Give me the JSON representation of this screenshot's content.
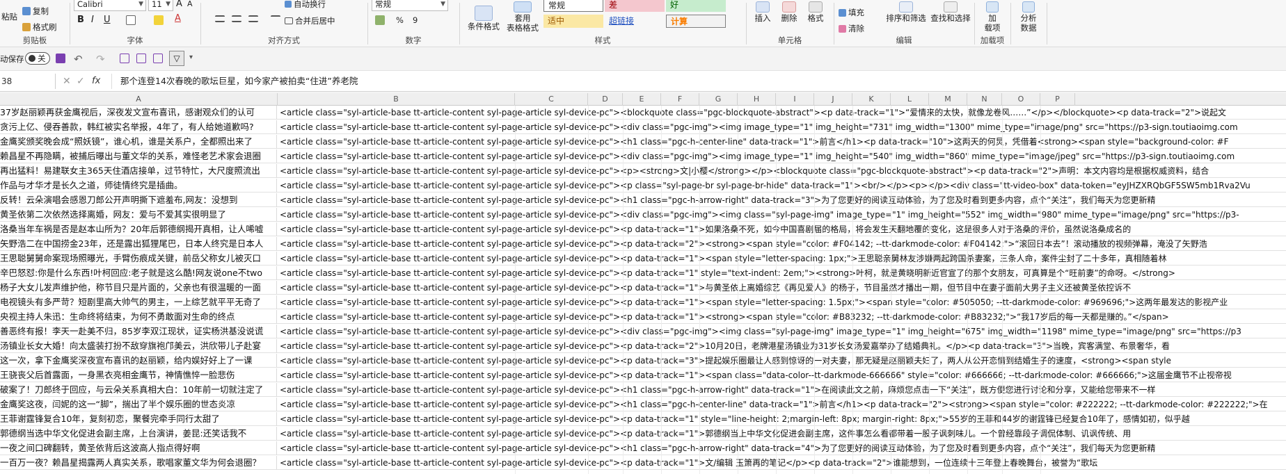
{
  "ribbon": {
    "clipboard": {
      "paste": "粘贴",
      "copy": "复制",
      "format_painter": "格式刷",
      "label": "剪贴板"
    },
    "font": {
      "name": "Calibri",
      "size": "11",
      "inc": "A",
      "dec": "A",
      "bold": "B",
      "italic": "I",
      "underline": "U",
      "font_color": "A",
      "label": "字体"
    },
    "alignment": {
      "wrap": "自动换行",
      "merge": "合并后居中",
      "label": "对齐方式"
    },
    "number": {
      "format": "常规",
      "percent": "%",
      "comma": "9",
      "label": "数字"
    },
    "styles": {
      "cond_format": "条件格式",
      "table_format_1": "套用",
      "table_format_2": "表格格式",
      "s_normal": "常规",
      "s_bad": "差",
      "s_good": "好",
      "s_neutral": "适中",
      "s_link": "超链接",
      "s_calc": "计算",
      "label": "样式"
    },
    "cells": {
      "insert": "插入",
      "delete": "删除",
      "format": "格式",
      "label": "单元格"
    },
    "editing": {
      "fill": "填充",
      "clear": "清除",
      "sort": "排序和筛选",
      "find": "查找和选择",
      "label": "编辑"
    },
    "addins": {
      "addin_1": "加",
      "addin_2": "载项",
      "label": "加载项"
    },
    "analysis": {
      "line1": "分析",
      "line2": "数据"
    }
  },
  "qat": {
    "autosave": "动保存",
    "toggle": "关"
  },
  "formula_bar": {
    "name_box": "38",
    "fx": "fx",
    "content": "那个连登14次春晚的歌坛巨星，如今家产被拍卖“住进”养老院"
  },
  "columns": [
    "A",
    "B",
    "C",
    "D",
    "E",
    "F",
    "G",
    "H",
    "I",
    "J",
    "K",
    "L",
    "M",
    "N",
    "O",
    "P"
  ],
  "rows": [
    {
      "a": "37岁赵丽颖再获金鹰视后，深夜发文宣布喜讯，感谢观众们的认可",
      "b": "<article class=\"syl-article-base tt-article-content syl-page-article syl-device-pc\"><blockquote class=\"pgc-blockquote-abstract\"><p data-track=\"1\">“爱情来的太快，就像龙卷风……”</p></blockquote><p data-track=\"2\">说起文"
    },
    {
      "a": "贪污上亿、侵吞善款，韩红被实名举报，4年了，有人给她道歉吗?",
      "b": "<article class=\"syl-article-base tt-article-content syl-page-article syl-device-pc\"><div class=\"pgc-img\"><img image_type=\"1\" img_height=\"731\" img_width=\"1300\" mime_type=\"image/png\" src=\"https://p3-sign.toutiaoimg.com"
    },
    {
      "a": "金鹰奖颁奖晚会成“照妖镜”，谁心机，谁是关系户，全都照出来了",
      "b": "<article class=\"syl-article-base tt-article-content syl-page-article syl-device-pc\"><h1 class=\"pgc-h-center-line\" data-track=\"1\">前言</h1><p data-track=\"10\">这两天的何炅，凭借着<strong><span style=\"background-color: #F"
    },
    {
      "a": "赖昌星不再隐瞒，被捕后曝出与董文华的关系，难怪老艺术家会退圈",
      "b": "<article class=\"syl-article-base tt-article-content syl-page-article syl-device-pc\"><div class=\"pgc-img\"><img image_type=\"1\" img_height=\"540\" img_width=\"860\" mime_type=\"image/jpeg\" src=\"https://p3-sign.toutiaoimg.com"
    },
    {
      "a": "再出猛料！易建联女主365天住酒店接单，过节特忙，大尺度照流出",
      "b": "<article class=\"syl-article-base tt-article-content syl-page-article syl-device-pc\"><p><strong>文|小樱</strong></p><blockquote class=\"pgc-blockquote-abstract\"><p data-track=\"2\">声明：本文内容均是根据权威资料，结合"
    },
    {
      "a": "作品与才华才是长久之道，师徒情终究是插曲。",
      "b": "<article class=\"syl-article-base tt-article-content syl-page-article syl-device-pc\"><p class=\"syl-page-br syl-page-br-hide\" data-track=\"1\"><br/></p><p></p><div class=\"tt-video-box\" data-token=\"eyJHZXRQbGF5SW5mb1Rva2Vu"
    },
    {
      "a": "反转！云朵演唱会感恩刀郎公开声明撕下遮羞布,网友：没想到",
      "b": "<article class=\"syl-article-base tt-article-content syl-page-article syl-device-pc\"><h1 class=\"pgc-h-arrow-right\" data-track=\"3\">为了您更好的阅读互动体验，为了您及时看到更多内容，点个“关注”，我们每天为您更新精"
    },
    {
      "a": "黄圣依第二次依然选择离婚，网友：爱与不爱其实很明显了",
      "b": "<article class=\"syl-article-base tt-article-content syl-page-article syl-device-pc\"><div class=\"pgc-img\"><img class=\"syl-page-img\" image_type=\"1\" img_height=\"552\" img_width=\"980\" mime_type=\"image/png\" src=\"https://p3-"
    },
    {
      "a": "洛桑当年车祸是否是赵本山所为？20年后郭德纲揭开真相，让人唏嘘",
      "b": "<article class=\"syl-article-base tt-article-content syl-page-article syl-device-pc\"><p data-track=\"1\">如果洛桑不死，如今中国喜剧届的格局，将会发生天翻地覆的变化，这是很多人对于洛桑的评价，虽然说洛桑成名的"
    },
    {
      "a": "矢野浩二在中国捞金23年，还是露出狐狸尾巴，日本人终究是日本人",
      "b": "<article class=\"syl-article-base tt-article-content syl-page-article syl-device-pc\"><p data-track=\"2\"><strong><span style=\"color: #F04142; --tt-darkmode-color: #F04142;\">“滚回日本去”！滚动播放的视频弹幕，淹没了矢野浩"
    },
    {
      "a": "王思聪舅舅命案现场照曝光，手臂伤痕成关键，前岳父称女儿被灭口",
      "b": "<article class=\"syl-article-base tt-article-content syl-page-article syl-device-pc\"><p data-track=\"1\"><span style=\"letter-spacing: 1px;\">王思聪亲舅林友涉嫌两起跨国杀妻案，三条人命，案件尘封了二十多年，真相随着林"
    },
    {
      "a": "辛巴怒怼:你是什么东西!叶柯回应:老子就是这么酷!网友说one不two",
      "b": "<article class=\"syl-article-base tt-article-content syl-page-article syl-device-pc\"><p data-track=\"1\" style=\"text-indent: 2em;\"><strong>叶柯，就是黄晓明新近官宣了的那个女朋友，可真算是个“旺前妻”的命呀。</strong>"
    },
    {
      "a": "杨子大女儿发声维护他，称节目只是片面的，父亲也有很温暖的一面",
      "b": "<article class=\"syl-article-base tt-article-content syl-page-article syl-device-pc\"><p data-track=\"1\">与黄圣依上离婚综艺《再见爱人》的杨子，节目虽然才播出一期，但节目中在妻子面前大男子主义还被黄圣依控诉不"
    },
    {
      "a": "电视镜头有多严苛？短剧里高大帅气的男主，一上综艺就平平无奇了",
      "b": "<article class=\"syl-article-base tt-article-content syl-page-article syl-device-pc\"><p data-track=\"1\"><span style=\"letter-spacing: 1.5px;\"><span style=\"color: #505050; --tt-darkmode-color: #969696;\">这两年最发达的影视产业"
    },
    {
      "a": "央视主持人朱迅：生命终将结束，为何不勇敢面对生命的终点",
      "b": "<article class=\"syl-article-base tt-article-content syl-page-article syl-device-pc\"><p data-track=\"1\"><strong><span style=\"color: #B83232; --tt-darkmode-color: #B83232;\">“我17岁后的每一天都是赚的。”</span>"
    },
    {
      "a": "善恶终有报！李天一赴美不归，85岁李双江现状，证实杨洪基没说谎",
      "b": "<article class=\"syl-article-base tt-article-content syl-page-article syl-device-pc\"><div class=\"pgc-img\"><img class=\"syl-page-img\" image_type=\"1\" img_height=\"675\" img_width=\"1198\" mime_type=\"image/png\" src=\"https://p3"
    },
    {
      "a": "汤镇业长女大婚！向太盛装打扮不敌穿旗袍邝美云，洪欣带儿子赴宴",
      "b": "<article class=\"syl-article-base tt-article-content syl-page-article syl-device-pc\"><p data-track=\"2\">10月20日，老牌港星汤镇业为31岁长女汤爱嘉举办了结婚典礼。</p><p data-track=\"3\">当晚，宾客满堂、布景奢华，看"
    },
    {
      "a": "这一次，拿下金鹰奖深夜宣布喜讯的赵丽颖，给内娱好好上了一课",
      "b": "<article class=\"syl-article-base tt-article-content syl-page-article syl-device-pc\"><p data-track=\"3\">提起娱乐圈最让人感到惊讶的一对夫妻，那无疑是赵丽颖夫妇了，两人从公开恋情到结婚生子的速度，<strong><span style"
    },
    {
      "a": "王骁丧父后首露面，一身黑衣亮相金鹰节，神情憔悴一脸悲伤",
      "b": "<article class=\"syl-article-base tt-article-content syl-page-article syl-device-pc\"><p data-track=\"1\"><span class=\"data-color--tt-darkmode-666666\" style=\"color: #666666; --tt-darkmode-color: #666666;\">这届金鹰节不止视帝视"
    },
    {
      "a": "破案了！刀郎终于回应，与云朵关系真相大白：10年前一切就注定了",
      "b": "<article class=\"syl-article-base tt-article-content syl-page-article syl-device-pc\"><h1 class=\"pgc-h-arrow-right\" data-track=\"1\">在阅读此文之前，麻烦您点击一下“关注”，既方便您进行讨论和分享，又能给您带来不一样"
    },
    {
      "a": "金鹰奖这夜，闫妮的这一“脚”，揣出了半个娱乐圈的世态炎凉",
      "b": "<article class=\"syl-article-base tt-article-content syl-page-article syl-device-pc\"><h1 class=\"pgc-h-center-line\" data-track=\"1\">前言</h1><p data-track=\"2\"><strong><span style=\"color: #222222; --tt-darkmode-color: #222222;\">在"
    },
    {
      "a": "王菲谢霆锋复合10年，复刻初恋，聚餐完牵手同行太甜了",
      "b": "<article class=\"syl-article-base tt-article-content syl-page-article syl-device-pc\"><p data-track=\"1\" style=\"line-height: 2;margin-left: 8px; margin-right: 8px;\">55岁的王菲和44岁的谢霆锋已经复合10年了，感情如初，似乎越"
    },
    {
      "a": "郭德纲当选中华文化促进会副主席，上台演讲，姜昆:还笑话我不",
      "b": "<article class=\"syl-article-base tt-article-content syl-page-article syl-device-pc\"><p data-track=\"1\">郭德纲当上中华文化促进会副主席，这件事怎么看都带着一股子讽刺味儿。一个曾经靠段子调侃体制、讥讽传统、用"
    },
    {
      "a": "一夜之间口碑翻转，黄圣依背后这波高人指点得好啊",
      "b": "<article class=\"syl-article-base tt-article-content syl-page-article syl-device-pc\"><h1 class=\"pgc-h-arrow-right\" data-track=\"4\">为了您更好的阅读互动体验，为了您及时看到更多内容，点个“关注”，我们每天为您更新精"
    },
    {
      "a": "一百万一夜？赖昌星揭露两人真实关系，歌唱家董文华为何会退圈？",
      "b": "<article class=\"syl-article-base tt-article-content syl-page-article syl-device-pc\"><p data-track=\"1\">文/编辑 玉箫再的笔记</p><p data-track=\"2\">谁能想到，一位连续十三年登上春晚舞台，被誉为“歌坛"
    }
  ]
}
